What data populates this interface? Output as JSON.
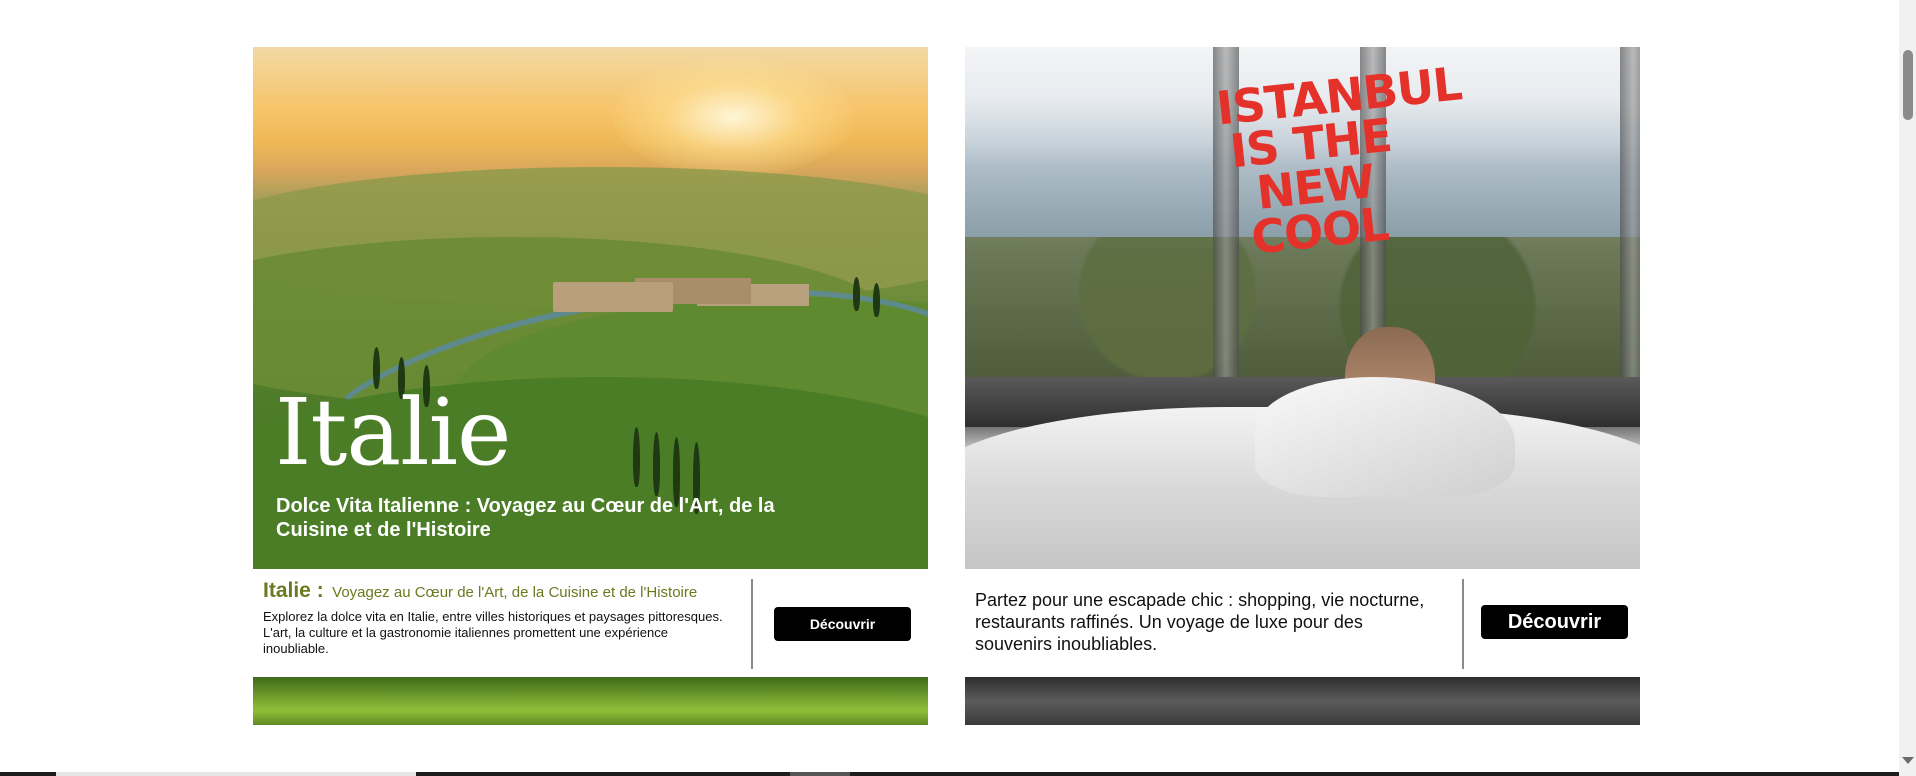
{
  "cards": [
    {
      "hero_title": "Italie",
      "hero_subtitle": "Dolce Vita Italienne : Voyagez au Cœur de l'Art, de la Cuisine et de l'Histoire",
      "heading_name": "Italie :",
      "heading_tagline": "Voyagez au Cœur de l'Art, de la Cuisine et de l'Histoire",
      "description": "Explorez la dolce vita en Italie, entre villes historiques et paysages pittoresques. L'art, la culture et la gastronomie italiennes promettent une expérience inoubliable.",
      "button_label": "Découvrir"
    },
    {
      "logo_text": "ISTANBUL IS THE NEW COOL",
      "description": "Partez pour une escapade chic : shopping, vie nocturne, restaurants raffinés. Un voyage de luxe pour des souvenirs inoubliables.",
      "button_label": "Découvrir"
    }
  ],
  "colors": {
    "accent_olive": "#6a7a1f",
    "button_bg": "#000000",
    "logo_red": "#e4322b"
  },
  "icons": {
    "scroll_down": "chevron-down-icon"
  }
}
